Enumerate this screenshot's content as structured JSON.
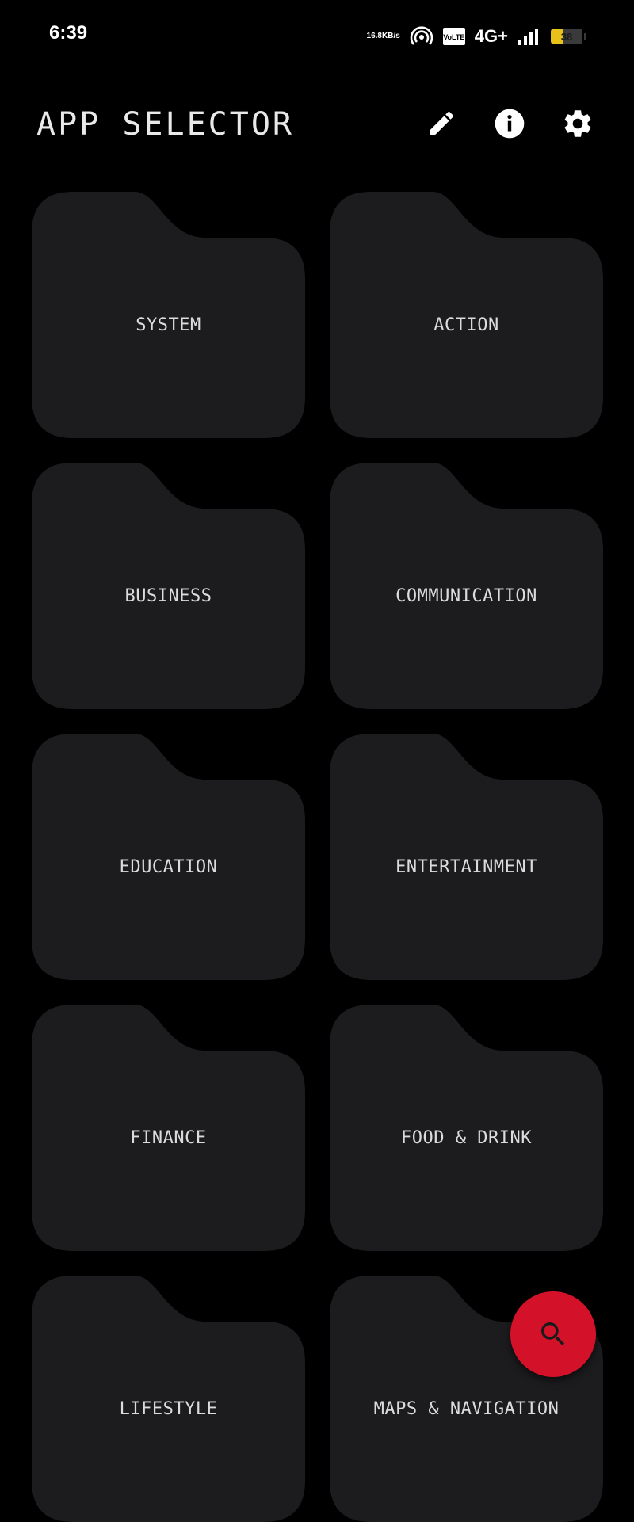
{
  "status_bar": {
    "time": "6:39",
    "net_speed_value": "16.8",
    "net_speed_unit": "KB/s",
    "volte_top": "Vo",
    "volte_bottom": "LTE",
    "network_type": "4G+",
    "battery_percent": "38",
    "battery_level": 0.38
  },
  "app_bar": {
    "title": "APP SELECTOR",
    "actions": [
      {
        "name": "edit",
        "icon": "pencil-icon"
      },
      {
        "name": "info",
        "icon": "info-icon"
      },
      {
        "name": "settings",
        "icon": "gear-icon"
      }
    ]
  },
  "categories": [
    {
      "label": "SYSTEM"
    },
    {
      "label": "ACTION"
    },
    {
      "label": "BUSINESS"
    },
    {
      "label": "COMMUNICATION"
    },
    {
      "label": "EDUCATION"
    },
    {
      "label": "ENTERTAINMENT"
    },
    {
      "label": "FINANCE"
    },
    {
      "label": "FOOD & DRINK"
    },
    {
      "label": "LIFESTYLE"
    },
    {
      "label": "MAPS & NAVIGATION"
    }
  ],
  "fab": {
    "icon": "search-icon"
  },
  "colors": {
    "background": "#000000",
    "folder": "#1c1b1e",
    "fab": "#d3122a",
    "text": "#dcdcdc"
  }
}
